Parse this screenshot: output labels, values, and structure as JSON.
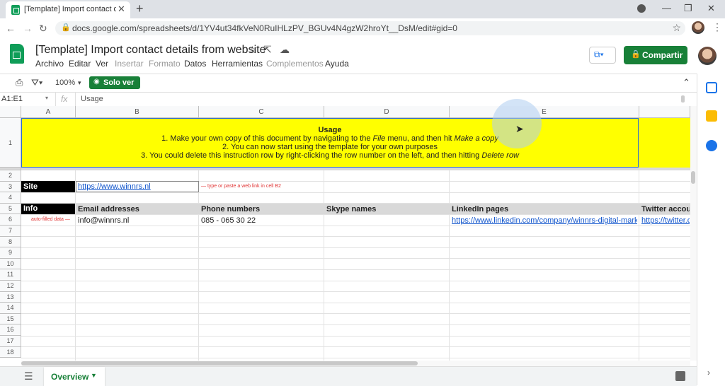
{
  "browser": {
    "tab_title": "[Template] Import contact details from website",
    "tab_close": "✕",
    "new_tab": "+",
    "url": "docs.google.com/spreadsheets/d/1YV4ut34fkVeN0RuIHLzPV_BGUv4N4gzW2hroYt__DsM/edit#gid=0",
    "window_controls": [
      "—",
      "❐",
      "✕"
    ]
  },
  "document": {
    "title": "[Template] Import contact details from website",
    "menus": [
      {
        "label": "Archivo",
        "enabled": true
      },
      {
        "label": "Editar",
        "enabled": true
      },
      {
        "label": "Ver",
        "enabled": true
      },
      {
        "label": "Insertar",
        "enabled": false
      },
      {
        "label": "Formato",
        "enabled": false
      },
      {
        "label": "Datos",
        "enabled": true
      },
      {
        "label": "Herramientas",
        "enabled": true
      },
      {
        "label": "Complementos",
        "enabled": false
      },
      {
        "label": "Ayuda",
        "enabled": true
      }
    ],
    "share_label": "Compartir",
    "brand_color": "#188038"
  },
  "toolbar": {
    "zoom": "100%",
    "view_mode_label": "Solo ver"
  },
  "formula_bar": {
    "name_box": "A1:E1",
    "fx": "fx",
    "value": "Usage"
  },
  "sheet": {
    "columns": [
      "A",
      "B",
      "C",
      "D",
      "E"
    ],
    "rows": [
      "1",
      "2",
      "3",
      "4",
      "5",
      "6",
      "7",
      "8",
      "9",
      "10",
      "11",
      "12",
      "13",
      "14",
      "15",
      "16",
      "17",
      "18"
    ],
    "usage": {
      "title": "Usage",
      "line1_pre": "1. Make your own copy of this document by navigating to the ",
      "line1_em1": "File",
      "line1_mid": " menu, and then hit ",
      "line1_em2": "Make a copy",
      "line2": "2. You can now start using the template for your own purposes",
      "line3_pre": "3. You could delete this instruction row by right-clicking the row number on the left, and then hitting ",
      "line3_em": "Delete row"
    },
    "site_label": "Site",
    "site_value": "https://www.winnrs.nl",
    "site_note": "— type or paste a web link in cell B2",
    "info_label": "Info",
    "headers": [
      "Email addresses",
      "Phone numbers",
      "Skype names",
      "LinkedIn pages",
      "Twitter accoun"
    ],
    "autofill_note": "auto-filled data —",
    "row6": {
      "email": "info@winnrs.nl",
      "phone": "085 - 065 30 22",
      "skype": "",
      "linkedin": "https://www.linkedin.com/company/winnrs-digital-marketing",
      "twitter": "https://twitter.co"
    },
    "highlight_color": "#ffff00"
  },
  "bottom": {
    "sheet_tab": "Overview"
  }
}
